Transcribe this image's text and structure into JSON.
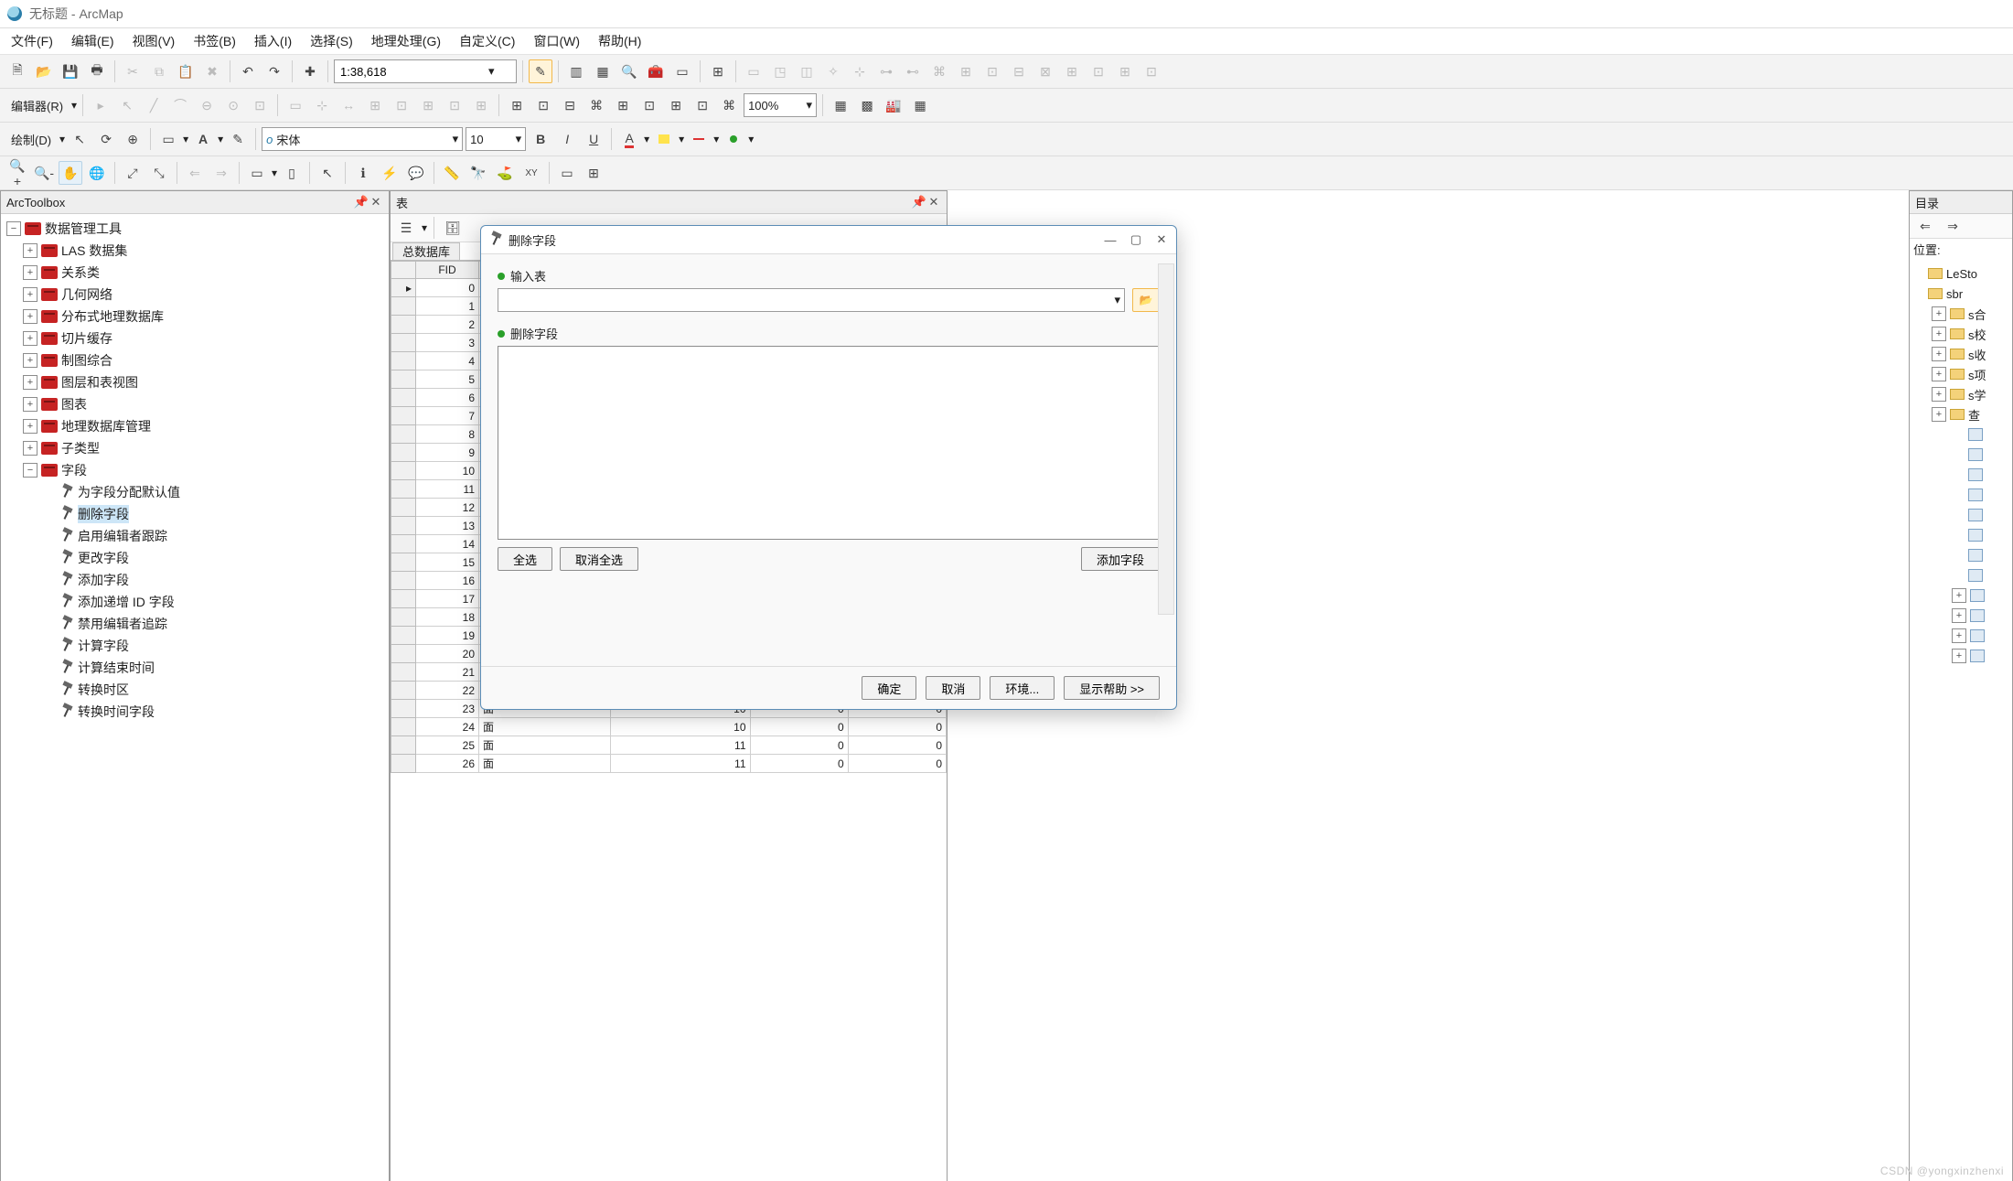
{
  "title": "无标题 - ArcMap",
  "menu": [
    "文件(F)",
    "编辑(E)",
    "视图(V)",
    "书签(B)",
    "插入(I)",
    "选择(S)",
    "地理处理(G)",
    "自定义(C)",
    "窗口(W)",
    "帮助(H)"
  ],
  "scale": "1:38,618",
  "editor_label": "编辑器(R)",
  "zoom_pct": "100%",
  "draw_label": "绘制(D)",
  "draw_font": "宋体",
  "draw_size": "10",
  "arctoolbox": {
    "title": "ArcToolbox",
    "root": "数据管理工具",
    "groups": [
      "LAS 数据集",
      "关系类",
      "几何网络",
      "分布式地理数据库",
      "切片缓存",
      "制图综合",
      "图层和表视图",
      "图表",
      "地理数据库管理",
      "子类型"
    ],
    "fields_group": "字段",
    "tools": [
      "为字段分配默认值",
      "删除字段",
      "启用编辑者跟踪",
      "更改字段",
      "添加字段",
      "添加递增 ID 字段",
      "禁用编辑者追踪",
      "计算字段",
      "计算结束时间",
      "转换时区",
      "转换时间字段"
    ]
  },
  "table": {
    "title": "表",
    "tab": "总数据库",
    "header_fid": "FID",
    "rows": [
      0,
      1,
      2,
      3,
      4,
      5,
      6,
      7,
      8,
      9,
      10,
      11,
      12,
      13,
      14,
      15,
      16,
      17,
      18,
      19,
      20,
      21,
      22
    ],
    "ext_rows": [
      {
        "n": 23,
        "c1": "面",
        "c2": 10,
        "c3": 0,
        "c4": 0
      },
      {
        "n": 24,
        "c1": "面",
        "c2": 10,
        "c3": 0,
        "c4": 0
      },
      {
        "n": 25,
        "c1": "面",
        "c2": 11,
        "c3": 0,
        "c4": 0
      },
      {
        "n": 26,
        "c1": "面",
        "c2": 11,
        "c3": 0,
        "c4": 0
      }
    ]
  },
  "dialog": {
    "title": "删除字段",
    "input_label": "输入表",
    "fields_label": "删除字段",
    "select_all": "全选",
    "deselect_all": "取消全选",
    "add_field": "添加字段",
    "ok": "确定",
    "cancel": "取消",
    "env": "环境...",
    "help": "显示帮助 >>"
  },
  "catalog": {
    "title": "目录",
    "loc_label": "位置:",
    "items": [
      "LeSto",
      "sbr",
      "s合",
      "s校",
      "s收",
      "s项",
      "s学",
      "查"
    ]
  },
  "watermark": "CSDN @yongxinzhenxi"
}
